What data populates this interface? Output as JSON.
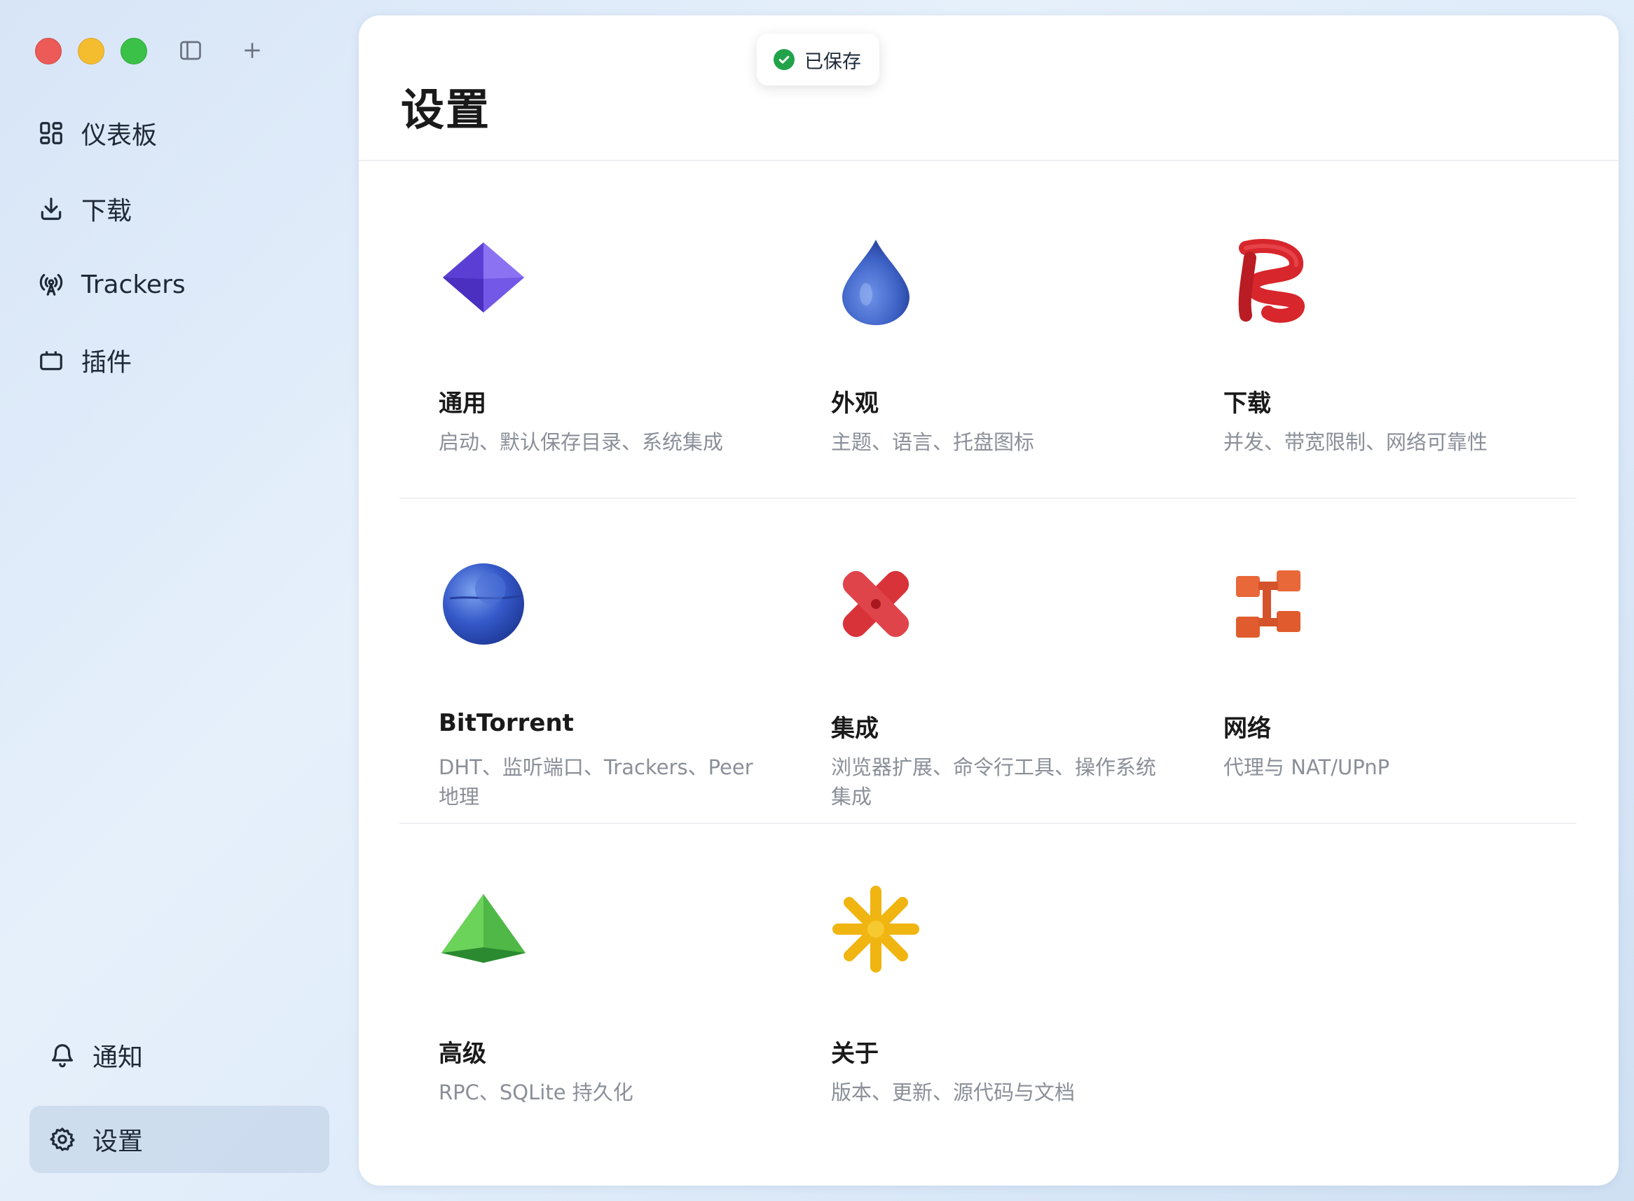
{
  "toast": {
    "text": "已保存"
  },
  "sidebar": {
    "items": [
      {
        "label": "仪表板",
        "icon": "dashboard-icon"
      },
      {
        "label": "下载",
        "icon": "download-icon"
      },
      {
        "label": "Trackers",
        "icon": "antenna-icon"
      },
      {
        "label": "插件",
        "icon": "plugin-icon"
      }
    ],
    "bottom": [
      {
        "label": "通知",
        "icon": "bell-icon"
      },
      {
        "label": "设置",
        "icon": "gear-icon",
        "active": true
      }
    ]
  },
  "main": {
    "title": "设置",
    "cards": [
      {
        "title": "通用",
        "desc": "启动、默认保存目录、系统集成",
        "icon": "purple-gem-icon"
      },
      {
        "title": "外观",
        "desc": "主题、语言、托盘图标",
        "icon": "blue-drop-icon"
      },
      {
        "title": "下载",
        "desc": "并发、带宽限制、网络可靠性",
        "icon": "red-coil-icon"
      },
      {
        "title": "BitTorrent",
        "desc": "DHT、监听端口、Trackers、Peer 地理",
        "icon": "blue-sphere-icon"
      },
      {
        "title": "集成",
        "desc": "浏览器扩展、命令行工具、操作系统集成",
        "icon": "red-cross-icon"
      },
      {
        "title": "网络",
        "desc": "代理与 NAT/UPnP",
        "icon": "orange-network-icon"
      },
      {
        "title": "高级",
        "desc": "RPC、SQLite 持久化",
        "icon": "green-pyramid-icon"
      },
      {
        "title": "关于",
        "desc": "版本、更新、源代码与文档",
        "icon": "yellow-star-icon"
      }
    ]
  }
}
